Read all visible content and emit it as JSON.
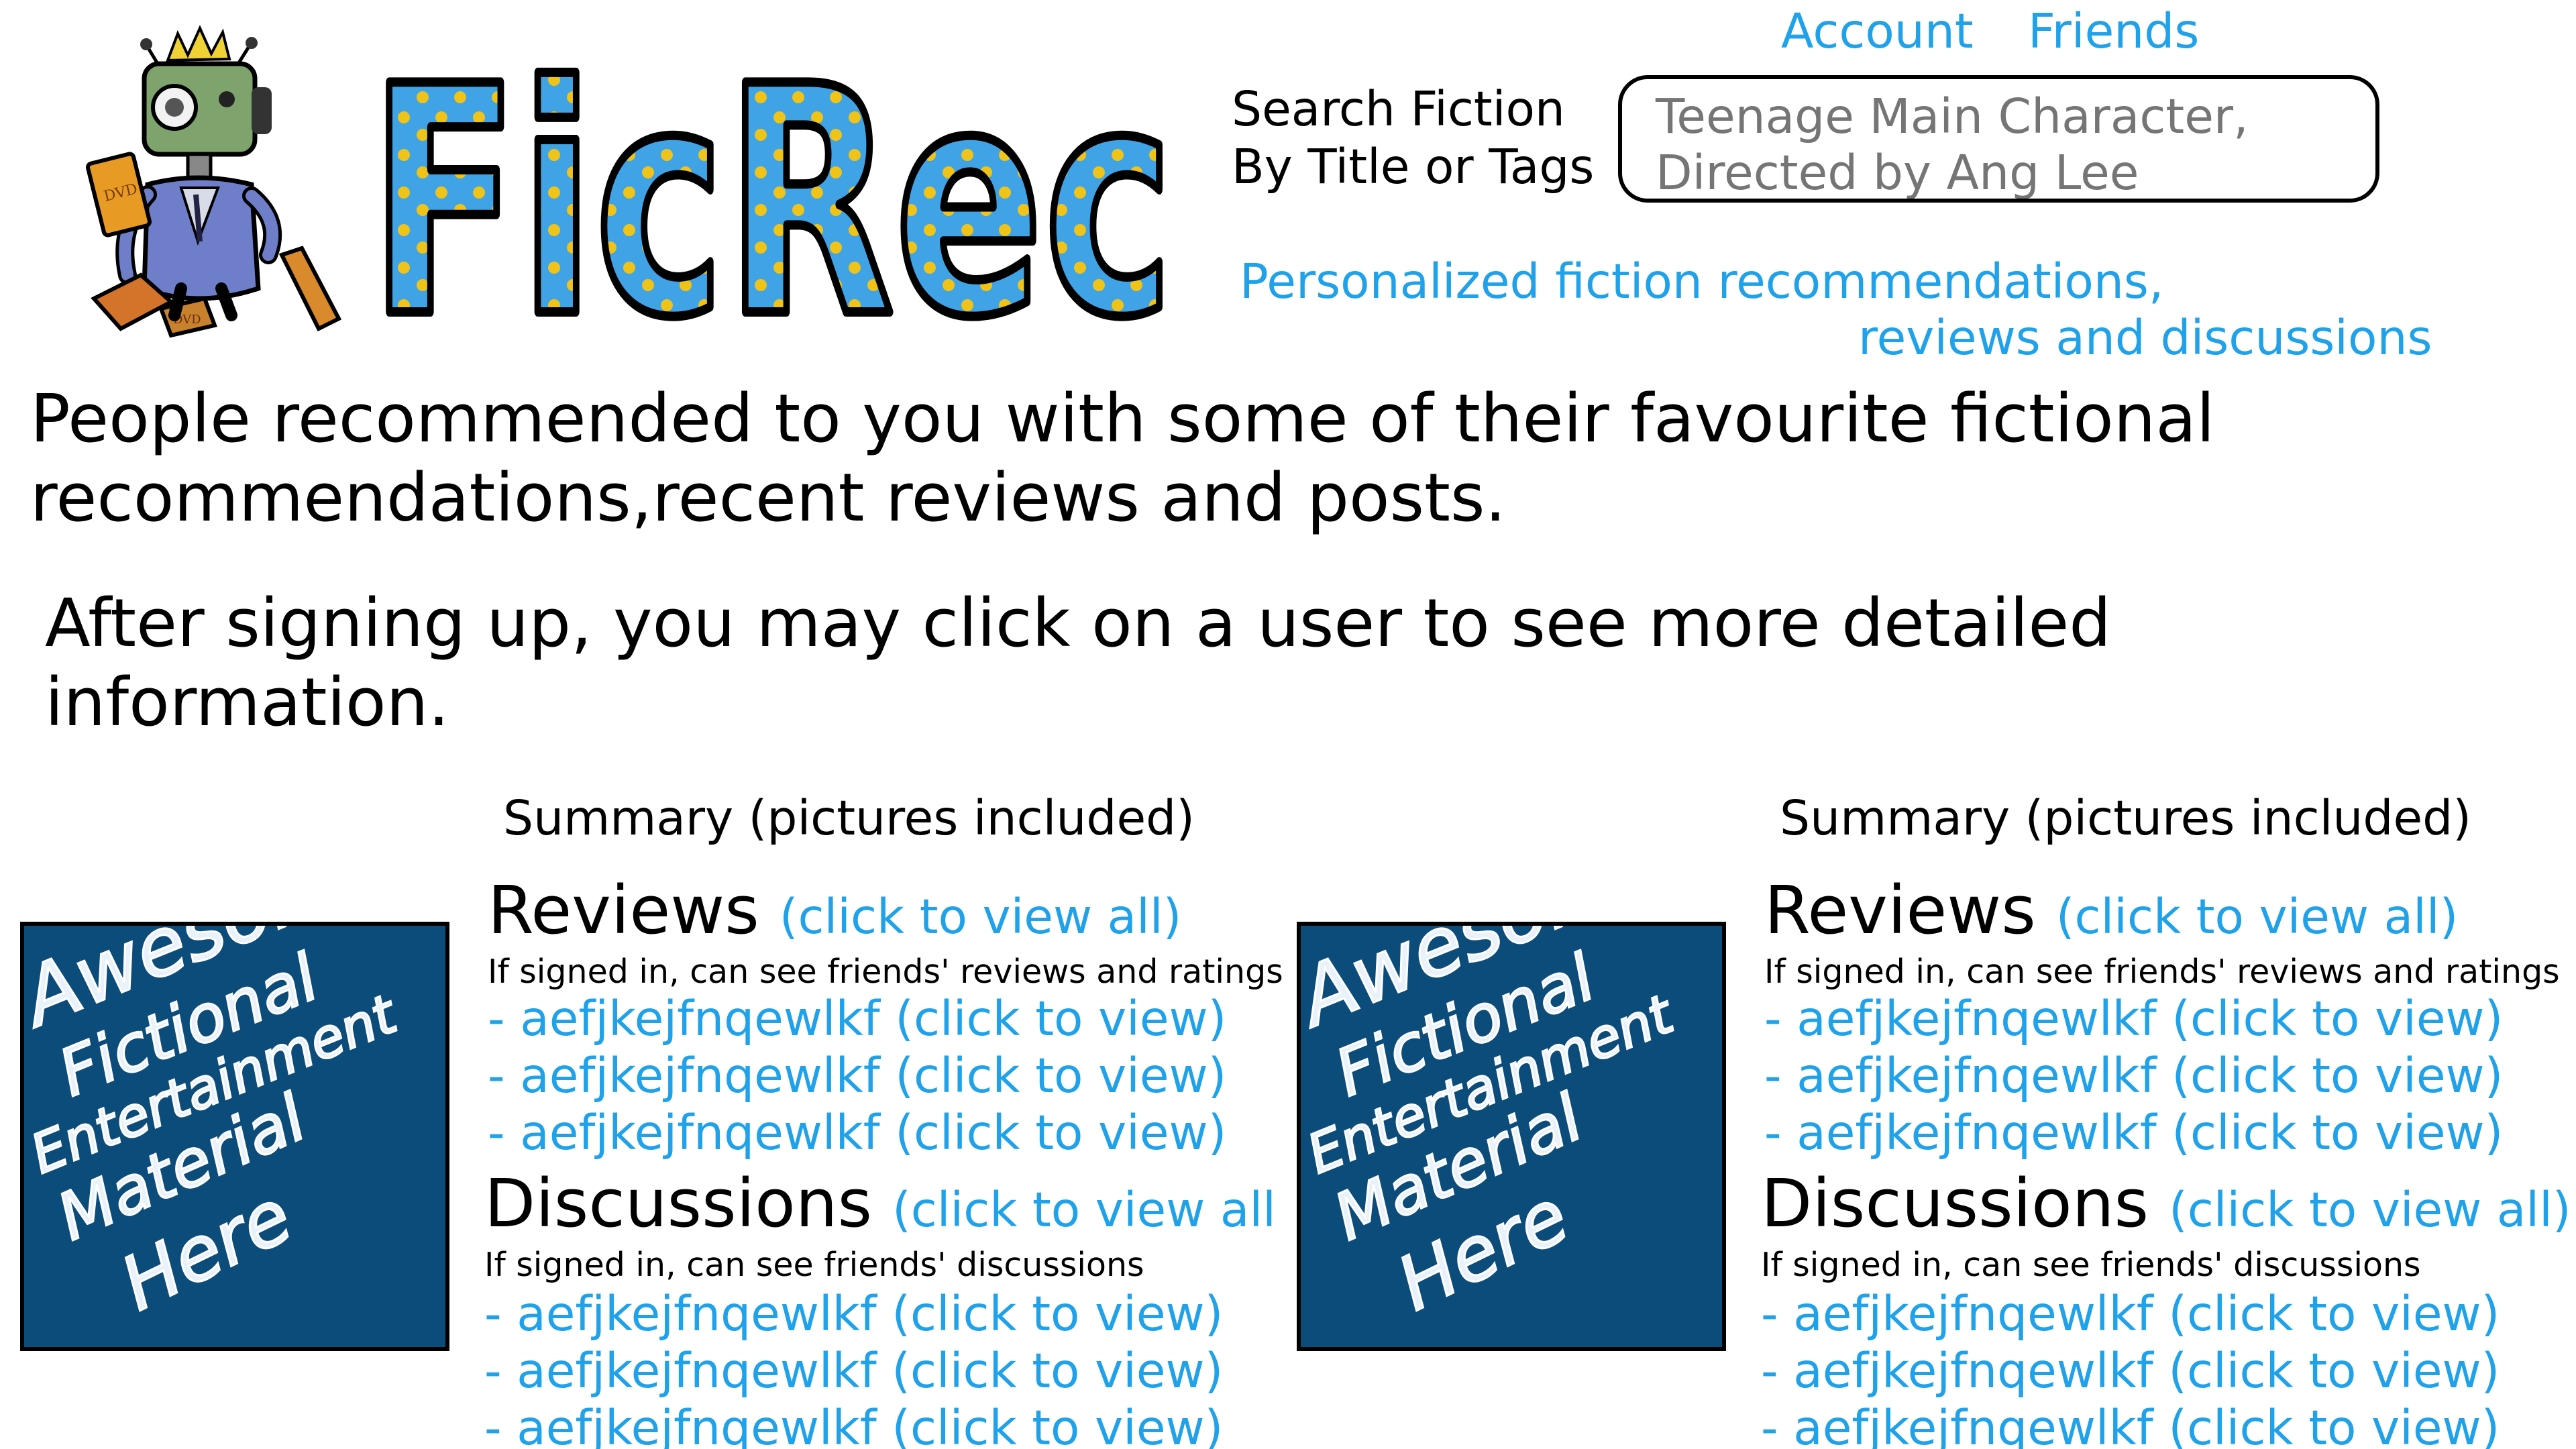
{
  "header": {
    "nav": {
      "account": "Account",
      "friends": "Friends"
    },
    "search": {
      "label_line1": "Search Fiction",
      "label_line2": "By Title or Tags",
      "placeholder": "Teenage Main Character,\nDirected by Ang Lee"
    },
    "tagline": {
      "line1": "Personalized fiction recommendations,",
      "line2": "reviews and discussions"
    },
    "logo": {
      "text": "FicRec",
      "colors": {
        "fill": "#3fa3e6",
        "dots": "#f0c318",
        "outline": "#000000"
      }
    },
    "mascot": {
      "icon": "robot-mascot-icon",
      "badge_text": "DVD"
    }
  },
  "intro": {
    "line1": "People recommended to you with some of their favourite fictional",
    "line2": "recommendations,recent reviews and posts.",
    "line3": "After signing up, you may click on a user to see more  detailed",
    "line4": "information."
  },
  "cards": [
    {
      "summary": "Summary (pictures included)",
      "thumbnail": {
        "lines": [
          "Awesome",
          "Fictional",
          "Entertainment",
          "Material",
          "Here"
        ],
        "bg": "#0b4c7a"
      },
      "reviews": {
        "title": "Reviews",
        "view_all": "(click to view all)",
        "note": "If signed in, can see friends' reviews and ratings",
        "items": [
          "- aefjkejfnqewlkf (click to view)",
          "- aefjkejfnqewlkf (click to view)",
          "- aefjkejfnqewlkf (click to view)"
        ]
      },
      "discussions": {
        "title": "Discussions",
        "view_all": "(click to view all",
        "note": "If signed in, can see friends' discussions",
        "items": [
          "- aefjkejfnqewlkf (click to view)",
          "- aefjkejfnqewlkf (click to view)",
          "- aefjkejfnqewlkf (click to view)"
        ]
      }
    },
    {
      "summary": "Summary (pictures included)",
      "thumbnail": {
        "lines": [
          "Awesome",
          "Fictional",
          "Entertainment",
          "Material",
          "Here"
        ],
        "bg": "#0b4c7a"
      },
      "reviews": {
        "title": "Reviews",
        "view_all": "(click to view all)",
        "note": "If signed in, can see friends' reviews and ratings",
        "items": [
          "- aefjkejfnqewlkf (click to view)",
          "- aefjkejfnqewlkf (click to view)",
          "- aefjkejfnqewlkf (click to view)"
        ]
      },
      "discussions": {
        "title": "Discussions",
        "view_all": "(click to view all)",
        "note": "If signed in, can see friends' discussions",
        "items": [
          "- aefjkejfnqewlkf (click to view)",
          "- aefjkejfnqewlkf (click to view)",
          "- aefjkejfnqewlkf (click to view)"
        ]
      }
    }
  ],
  "colors": {
    "link": "#1fa2ea",
    "search_text": "#0e4a74",
    "thumbnail_bg": "#0b4c7a",
    "text": "#000000"
  }
}
